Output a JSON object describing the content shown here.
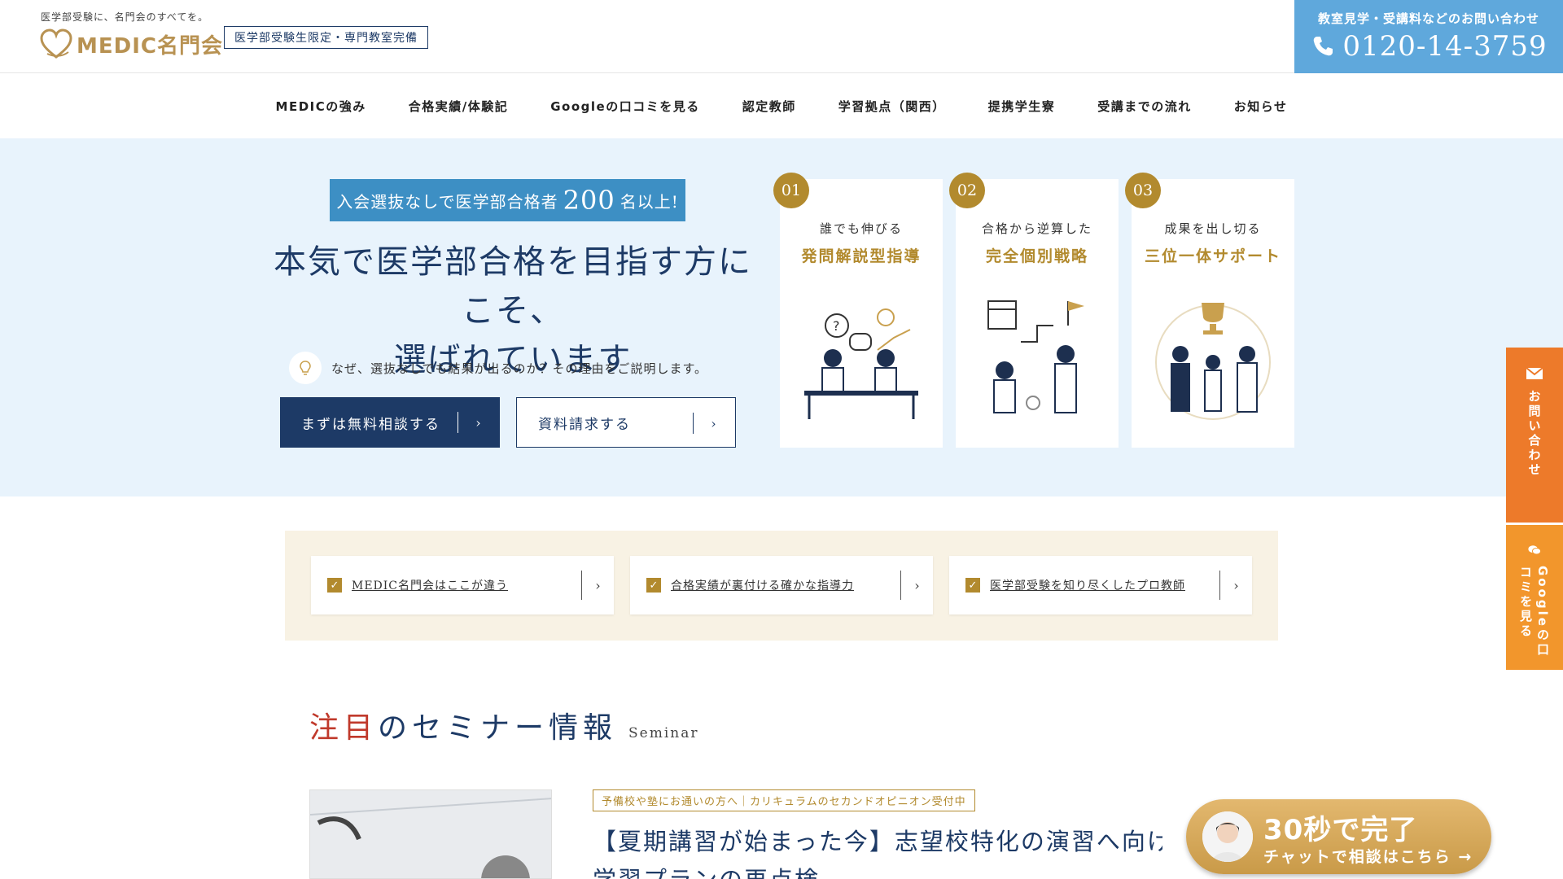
{
  "header": {
    "tagline": "医学部受験に、名門会のすべてを。",
    "logo_text": "MEDIC名門会",
    "badge": "医学部受験生限定・専門教室完備",
    "phone_caption": "教室見学・受講料などのお問い合わせ",
    "phone_number": "0120-14-3759"
  },
  "nav": {
    "items": [
      {
        "label": "MEDICの強み"
      },
      {
        "label": "合格実績/体験記"
      },
      {
        "label": "Googleの口コミを見る"
      },
      {
        "label": "認定教師"
      },
      {
        "label": "学習拠点（関西）"
      },
      {
        "label": "提携学生寮"
      },
      {
        "label": "受講までの流れ"
      },
      {
        "label": "お知らせ"
      }
    ]
  },
  "hero": {
    "ribbon_pre": "入会選抜なしで医学部合格者",
    "ribbon_number": "200",
    "ribbon_post": "名以上!",
    "title_line1": "本気で医学部合格を目指す方にこそ、",
    "title_line2": "選ばれています",
    "reason": "なぜ、選抜なしでも結果が出るのか？その理由をご説明します。",
    "primary_button": "まずは無料相談する",
    "secondary_button": "資料請求する",
    "features": [
      {
        "num": "01",
        "sub": "誰でも伸びる",
        "main": "発問解説型指導"
      },
      {
        "num": "02",
        "sub": "合格から逆算した",
        "main": "完全個別戦略"
      },
      {
        "num": "03",
        "sub": "成果を出し切る",
        "main": "三位一体サポート"
      }
    ]
  },
  "quick_links": [
    {
      "label": "MEDIC名門会はここが違う"
    },
    {
      "label": "合格実績が裏付ける確かな指導力"
    },
    {
      "label": "医学部受験を知り尽くしたプロ教師"
    }
  ],
  "seminar": {
    "heading_accent": "注目",
    "heading_rest": "のセミナー情報",
    "heading_en": "Seminar",
    "tag": "予備校や塾にお通いの方へ｜カリキュラムのセカンドオピニオン受付中",
    "title_line1": "【夏期講習が始まった今】志望校特化の演習へ向け",
    "title_line2": "学習プランの再点検"
  },
  "side_tabs": {
    "contact": "お問い合わせ",
    "google": "Googleの口コミを見る"
  },
  "chat": {
    "big": "30秒で完了",
    "small": "チャットで相談はこちら →"
  },
  "colors": {
    "navy": "#1d3a66",
    "gold": "#b28a2e",
    "sky": "#5fa8dc",
    "orange": "#ed7a2a",
    "hero_bg": "#e8f3fc"
  }
}
